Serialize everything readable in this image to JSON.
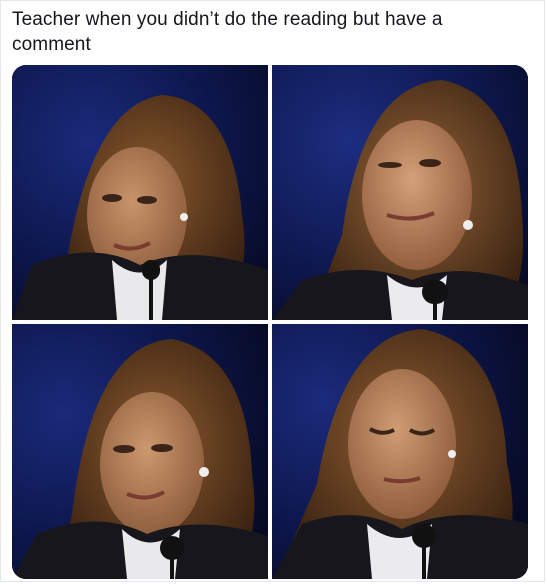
{
  "post": {
    "caption": "Teacher when you didn’t do the reading but have a comment"
  },
  "photos": [
    {
      "name": "photo-top-left"
    },
    {
      "name": "photo-top-right"
    },
    {
      "name": "photo-bottom-left"
    },
    {
      "name": "photo-bottom-right"
    }
  ]
}
